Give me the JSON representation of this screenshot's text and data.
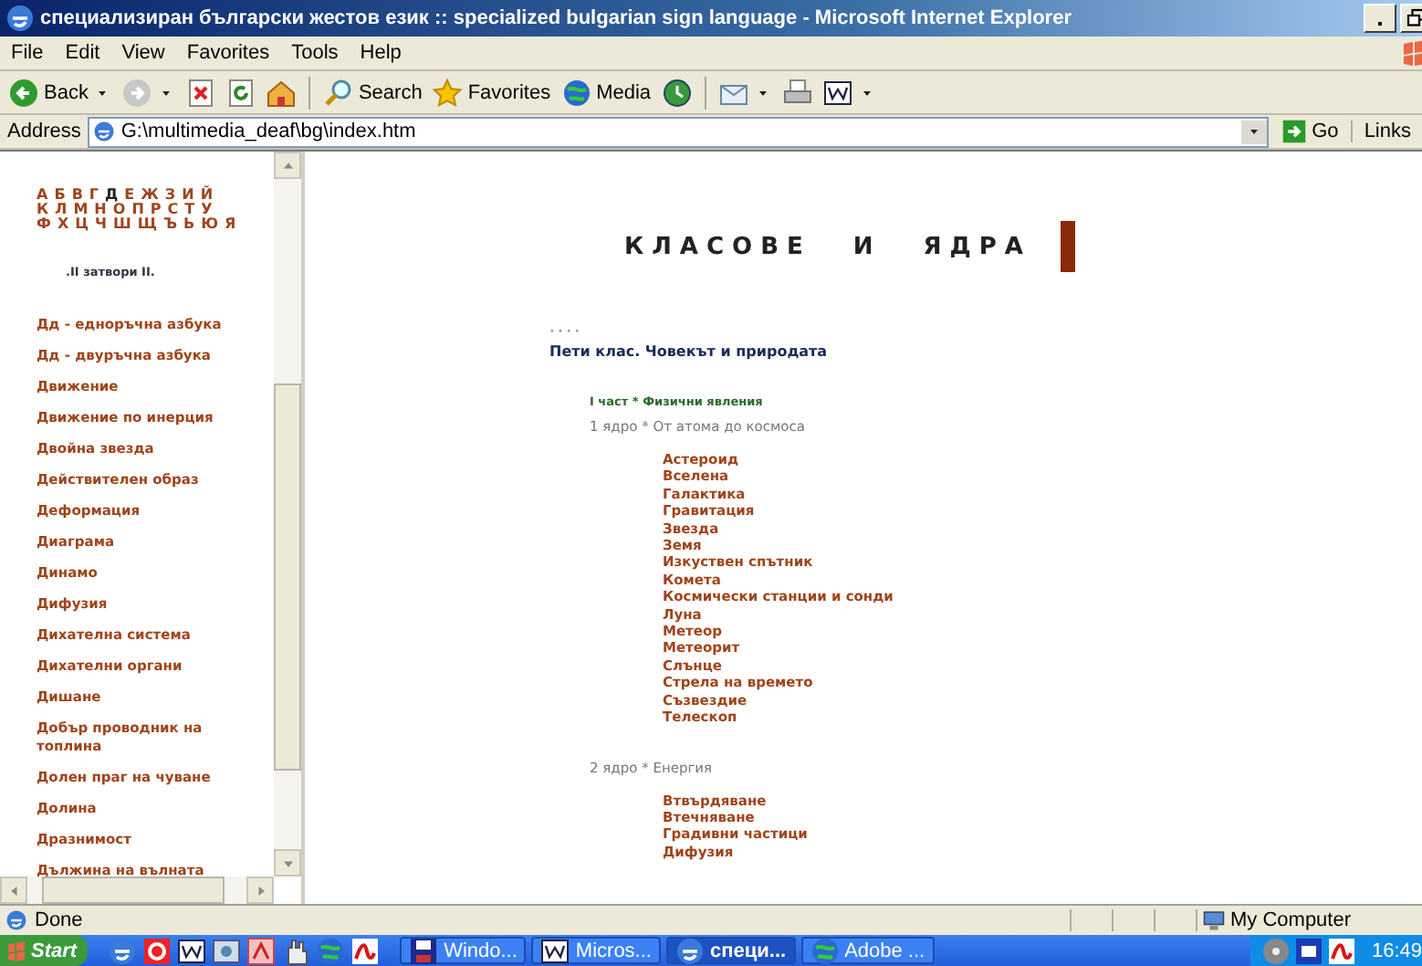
{
  "window": {
    "title": "специализиран български жестов език :: specialized bulgarian sign language - Microsoft Internet Explorer"
  },
  "menu": [
    "File",
    "Edit",
    "View",
    "Favorites",
    "Tools",
    "Help"
  ],
  "toolbar": [
    {
      "kind": "back",
      "label": "Back",
      "caret": true
    },
    {
      "kind": "forward",
      "caret": true
    },
    {
      "kind": "stop"
    },
    {
      "kind": "refresh"
    },
    {
      "kind": "home"
    },
    {
      "kind": "search",
      "label": "Search"
    },
    {
      "kind": "favorites",
      "label": "Favorites"
    },
    {
      "kind": "media",
      "label": "Media"
    },
    {
      "kind": "history"
    },
    {
      "kind": "mail",
      "caret": true
    },
    {
      "kind": "print"
    },
    {
      "kind": "word",
      "caret": true
    }
  ],
  "address": {
    "label": "Address",
    "value": "G:\\multimedia_deaf\\bg\\index.htm",
    "go": "Go",
    "links": "Links"
  },
  "sidebar": {
    "alphabet": [
      [
        {
          "letter": "А",
          "selected": false
        },
        {
          "letter": "Б",
          "selected": false
        },
        {
          "letter": "В",
          "selected": false
        },
        {
          "letter": "Г",
          "selected": false
        },
        {
          "letter": "Д",
          "selected": true
        },
        {
          "letter": "Е",
          "selected": false
        },
        {
          "letter": "Ж",
          "selected": false
        },
        {
          "letter": "З",
          "selected": false
        },
        {
          "letter": "И",
          "selected": false
        },
        {
          "letter": "Й",
          "selected": false
        }
      ],
      [
        {
          "letter": "К",
          "selected": false
        },
        {
          "letter": "Л",
          "selected": false
        },
        {
          "letter": "М",
          "selected": false
        },
        {
          "letter": "Н",
          "selected": false
        },
        {
          "letter": "О",
          "selected": false
        },
        {
          "letter": "П",
          "selected": false
        },
        {
          "letter": "Р",
          "selected": false
        },
        {
          "letter": "С",
          "selected": false
        },
        {
          "letter": "Т",
          "selected": false
        },
        {
          "letter": "У",
          "selected": false
        }
      ],
      [
        {
          "letter": "Ф",
          "selected": false
        },
        {
          "letter": "Х",
          "selected": false
        },
        {
          "letter": "Ц",
          "selected": false
        },
        {
          "letter": "Ч",
          "selected": false
        },
        {
          "letter": "Ш",
          "selected": false
        },
        {
          "letter": "Щ",
          "selected": false
        },
        {
          "letter": "Ъ",
          "selected": false
        },
        {
          "letter": "Ь",
          "selected": false
        },
        {
          "letter": "Ю",
          "selected": false
        },
        {
          "letter": "Я",
          "selected": false
        }
      ]
    ],
    "close_link": ".II затвори II.",
    "items": [
      "Дд - еднoръчна азбука",
      "Дд - двуръчна азбука",
      "Движение",
      "Движение по инерция",
      "Двойна звезда",
      "Действителен образ",
      "Деформация",
      "Диаграма",
      "Динамо",
      "Дифузия",
      "Дихателна система",
      "Дихателни органи",
      "Дишане",
      "Добър проводник на топлина",
      "Долен праг на чуване",
      "Долина",
      "Дразнимост",
      "Дължина на вълната"
    ]
  },
  "main": {
    "heading": "КЛАСОВЕ И ЯДРА",
    "dots": "• • • •",
    "title": "Пети клас. Човекът и природата",
    "part": "I част * Физични явления",
    "sections": [
      {
        "heading": "1 ядро * От атома до космоса",
        "items": [
          "Астероид",
          "Вселена",
          "Галактика",
          "Гравитация",
          "Звезда",
          "Земя",
          "Изкуствен спътник",
          "Комета",
          "Космически станции и сонди",
          "Луна",
          "Метеор",
          "Метеорит",
          "Слънце",
          "Стрела на времето",
          "Съзвездие",
          "Телескоп"
        ]
      },
      {
        "heading": "2 ядро * Енергия",
        "items": [
          "Втвърдяване",
          "Втечняване",
          "Градивни частици",
          "Дифузия"
        ]
      }
    ]
  },
  "status_bar": {
    "text": "Done",
    "zone": "My Computer"
  },
  "taskbar": {
    "start": "Start",
    "quick_launch": [
      {
        "kind": "ie"
      },
      {
        "kind": "e"
      },
      {
        "kind": "word"
      },
      {
        "kind": "cam"
      },
      {
        "kind": "pdf"
      },
      {
        "kind": "hand"
      },
      {
        "kind": "media"
      },
      {
        "kind": "acro"
      }
    ],
    "tasks": [
      {
        "kind": "disk",
        "label": "Windo...",
        "selected": false
      },
      {
        "kind": "word",
        "label": "Micros...",
        "selected": false
      },
      {
        "kind": "ie",
        "label": "специ...",
        "selected": true
      },
      {
        "kind": "media",
        "label": "Adobe ...",
        "selected": false
      }
    ],
    "tray": [
      {
        "kind": "cd"
      },
      {
        "kind": "lang"
      },
      {
        "kind": "acro"
      }
    ],
    "clock": "16:49"
  }
}
